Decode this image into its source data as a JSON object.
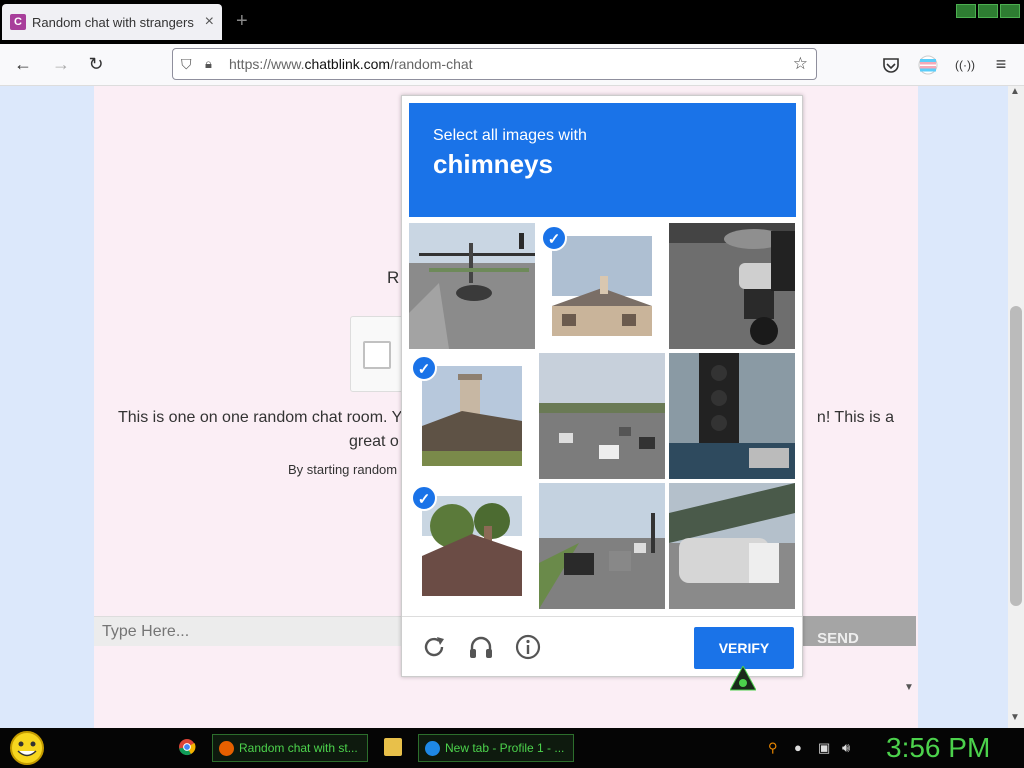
{
  "browser": {
    "tab_title": "Random chat with strangers",
    "tab_favicon": "C",
    "url_prefix": "https://www.",
    "url_domain": "chatblink.com",
    "url_path": "/random-chat"
  },
  "page": {
    "partial_heading": "R",
    "para1": "This is one on one random chat room. Y",
    "para1_end": "n! This is a",
    "para1_line2": "great o",
    "para2": "By starting random",
    "input_placeholder": "Type Here...",
    "send_label": "SEND"
  },
  "captcha": {
    "instruction": "Select all images with",
    "target": "chimneys",
    "verify_label": "VERIFY",
    "tiles": [
      {
        "name": "tile-intersection",
        "selected": false
      },
      {
        "name": "tile-house-chimney-1",
        "selected": true
      },
      {
        "name": "tile-motorcycle",
        "selected": false
      },
      {
        "name": "tile-roof-chimney-2",
        "selected": true
      },
      {
        "name": "tile-road-traffic",
        "selected": false
      },
      {
        "name": "tile-traffic-light",
        "selected": false
      },
      {
        "name": "tile-roof-chimney-3",
        "selected": true
      },
      {
        "name": "tile-highway-cars",
        "selected": false
      },
      {
        "name": "tile-bridge-truck",
        "selected": false
      }
    ],
    "footer_icons": [
      "reload-icon",
      "audio-icon",
      "info-icon"
    ]
  },
  "taskbar": {
    "task1": "Random chat with st...",
    "task2": "New tab - Profile 1 - ...",
    "clock": "3:56 PM"
  },
  "colors": {
    "accent": "#1a73e8",
    "page_bg": "#fbeef5",
    "taskbar_text": "#4cd24c"
  }
}
